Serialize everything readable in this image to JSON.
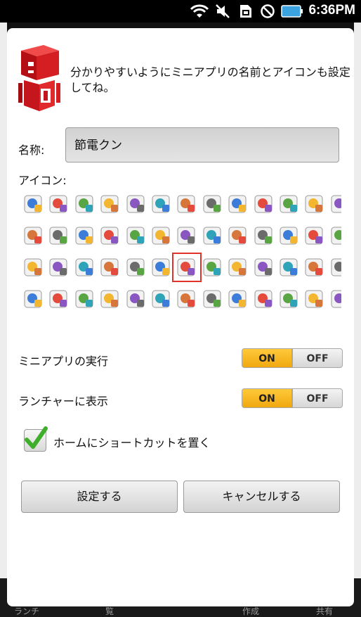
{
  "status_bar": {
    "time": "6:36PM",
    "icons": [
      "wifi-icon",
      "mute-icon",
      "sim-icon",
      "blocked-icon",
      "battery-icon"
    ]
  },
  "background": {
    "tabs": [
      "ランチ",
      "覧",
      "作成",
      "共有"
    ]
  },
  "dialog": {
    "message": "分かりやすいようにミニアプリの名前とアイコンも設定してね。",
    "name_label": "名称:",
    "name_value": "節電クン",
    "icon_label": "アイコン:",
    "icons": [
      "speaker-add-icon",
      "speaker-remove-icon",
      "computer-plus-icon",
      "computer-transfer-icon",
      "computer-search-icon",
      "people-icon",
      "burger-icon",
      "chat-bubble-icon",
      "desktop-icon",
      "house-icon",
      "house-info-icon",
      "house-check-icon",
      "people-pizza-icon",
      "people-more-icon",
      "calendar-28-icon",
      "hello-bubble-icon",
      "widget-icon",
      "book-icon",
      "info-bubble-icon",
      "soccer-ball-icon",
      "box-icon",
      "globe-icon",
      "key-icon",
      "bookshelf-icon",
      "clipboard-icon",
      "mail-icon",
      "piggy-bank-icon",
      "robot-blue-icon",
      "robot-yellow-icon",
      "robot-green-icon",
      "robot-purple-icon",
      "headphones-icon",
      "chart-icon",
      "light-bulb-icon",
      "speaker-icon",
      "screen-icon",
      "bluetooth-icon",
      "phone-audio-icon",
      "photo-icon",
      "layout-icon",
      "window-icon",
      "grid-icon",
      "stopwatch-icon",
      "timer-icon",
      "gmail-icon",
      "calendar-icon",
      "phone-icon",
      "pen-icon",
      "book-red-icon",
      "window-blue-icon",
      "globe-refresh-icon",
      "calendar-blue-icon",
      "pages-icon"
    ],
    "selected_icon_index": 33,
    "settings": [
      {
        "label": "ミニアプリの実行",
        "on": "ON",
        "off": "OFF",
        "value": "ON"
      },
      {
        "label": "ランチャーに表示",
        "on": "ON",
        "off": "OFF",
        "value": "ON"
      }
    ],
    "checkbox": {
      "label": "ホームにショートカットを置く",
      "checked": true
    },
    "buttons": {
      "confirm": "設定する",
      "cancel": "キャンセルする"
    }
  }
}
